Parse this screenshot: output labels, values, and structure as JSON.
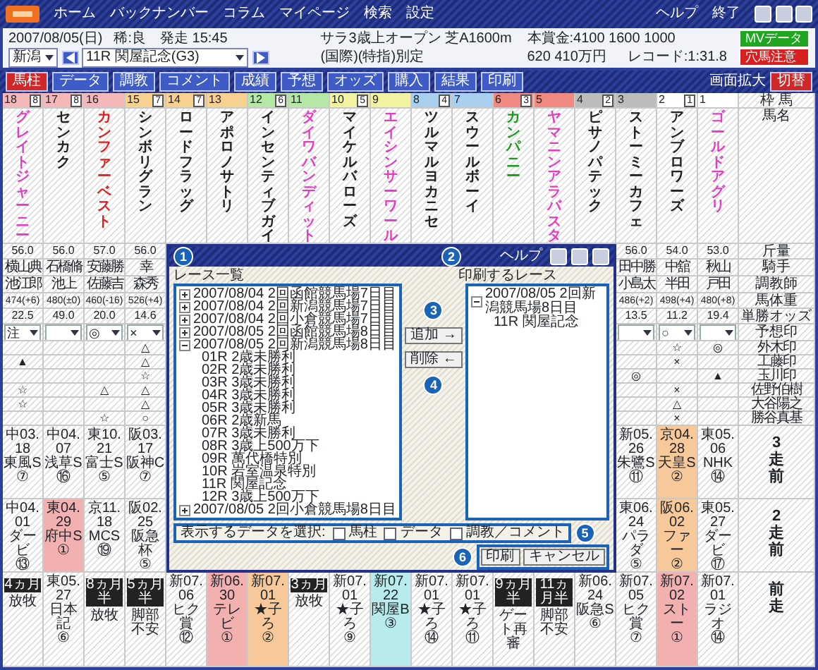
{
  "app": {
    "menu": [
      "ホーム",
      "バックナンバー",
      "コラム",
      "マイページ",
      "検索",
      "設定"
    ],
    "help": "ヘルプ",
    "quit": "終了"
  },
  "race_info": {
    "date": "2007/08/05(日)",
    "going": "稀:良",
    "post_time": "発走 15:45",
    "class": "サラ3歳上オープン 芝A1600m",
    "prize": "本賞金:4100 1600 1000",
    "record": "レコード:1:31.8",
    "track": "新潟",
    "race": "11R 関屋記念(G3)",
    "conditions": "(国際)(特指)別定",
    "prize_2": "620 410万円",
    "badges": [
      {
        "label": "MVデータ",
        "color": "#21a621"
      },
      {
        "label": "穴馬注意",
        "color": "#d82020"
      }
    ]
  },
  "toolbar": {
    "buttons": [
      {
        "label": "馬柱",
        "selected": true
      },
      {
        "label": "データ",
        "selected": false
      },
      {
        "label": "調教",
        "selected": false
      },
      {
        "label": "コメント",
        "selected": false
      },
      {
        "label": "成績",
        "selected": false
      },
      {
        "label": "予想",
        "selected": false
      },
      {
        "label": "オッズ",
        "selected": false
      },
      {
        "label": "購入",
        "selected": false
      },
      {
        "label": "結果",
        "selected": false
      },
      {
        "label": "印刷",
        "selected": false
      }
    ],
    "zoom_label": "画面拡大",
    "zoom_toggle": "切替"
  },
  "horses": [
    {
      "number": "18",
      "waku": "8",
      "color": "#f4b8b8",
      "name": "グレイトジャーニー",
      "kind": "pink",
      "weight": "56.0",
      "jockey": "横山典",
      "trainer": "池江郎",
      "body_weight": "474(+6)",
      "odds": "22.5",
      "mark": "注",
      "marks": {
        "row_2": "▲",
        "row_4": "☆",
        "row_5": "☆"
      },
      "race_3": {
        "kind": "race",
        "date": "中03.18",
        "race": "東風S",
        "rank": "⑦"
      },
      "race_2": {
        "kind": "race",
        "date": "中04.01",
        "race": "ダービ",
        "rank": "⑬"
      },
      "race_1": {
        "kind": "rest",
        "period": "4ヵ月",
        "reason": "放牧"
      }
    },
    {
      "number": "17",
      "waku": "8",
      "color": "#f4b8b8",
      "name": "センカク",
      "kind": "plain",
      "weight": "56.0",
      "jockey": "石橋脩",
      "trainer": "池上",
      "body_weight": "480(±0)",
      "odds": "49.0",
      "race_3": {
        "kind": "race",
        "date": "中04.07",
        "race": "浅草S",
        "rank": "⑯"
      },
      "race_2": {
        "kind": "race",
        "date": "東04.29",
        "race": "府中S",
        "rank": "①",
        "color": "#f2b0b0"
      },
      "race_1": {
        "kind": "race",
        "date": "東05.27",
        "race": "日本記",
        "rank": "⑥"
      }
    },
    {
      "number": "16",
      "color": "#f4b8b8",
      "name": "カンファーベスト",
      "kind": "red",
      "weight": "57.0",
      "jockey": "安藤勝",
      "trainer": "佐藤吉",
      "body_weight": "460(-16)",
      "odds": "20.0",
      "mark": "◎",
      "marks": {
        "row_4": "△",
        "row_6": "☆"
      },
      "race_3": {
        "kind": "race",
        "date": "東10.21",
        "race": "富士S",
        "rank": "⑤"
      },
      "race_2": {
        "kind": "race",
        "date": "京11.18",
        "race": "MCS",
        "rank": "⑲"
      },
      "race_1": {
        "kind": "rest",
        "period": "8ヵ月半",
        "reason": "放牧"
      }
    },
    {
      "number": "15",
      "waku": "7",
      "color": "#f8d090",
      "name": "シンボリグラン",
      "kind": "plain",
      "weight": "56.0",
      "jockey": "幸",
      "trainer": "森秀",
      "body_weight": "526(+4)",
      "odds": "14.6",
      "mark": "×",
      "marks": {
        "row_1": "△",
        "row_2": "△",
        "row_3": "☆",
        "row_4": "△",
        "row_5": "△",
        "row_6": "○"
      },
      "race_3": {
        "kind": "race",
        "date": "阪03.17",
        "race": "阪神C",
        "rank": "⑦"
      },
      "race_2": {
        "kind": "race",
        "date": "阪02.25",
        "race": "阪急杯",
        "rank": "⑤"
      },
      "race_1": {
        "kind": "rest",
        "period": "5ヵ月半",
        "reason": "脚部不安"
      }
    },
    {
      "number": "14",
      "waku": "7",
      "color": "#f8d090",
      "name": "ロードフラッグ",
      "kind": "plain",
      "race_1": {
        "kind": "race",
        "date": "新07.06",
        "race": "ヒク賞",
        "rank": "⑫"
      }
    },
    {
      "number": "13",
      "color": "#f8d090",
      "name": "アポロノサトリ",
      "kind": "plain",
      "race_1": {
        "kind": "race",
        "date": "新06.30",
        "race": "テレビ",
        "rank": "①",
        "color": "#f2b0b0"
      }
    },
    {
      "number": "12",
      "waku": "6",
      "color": "#b4e8a4",
      "name": "インセンティブガイ",
      "kind": "plain",
      "race_1": {
        "kind": "race",
        "date": "新07.01",
        "race": "★子ろ",
        "rank": "②",
        "color": "#f6c89a"
      }
    },
    {
      "number": "11",
      "color": "#b4e8a4",
      "name": "ダイワバンディット",
      "kind": "pink",
      "race_1": {
        "kind": "rest",
        "period": "3ヵ月",
        "reason": "放牧"
      }
    },
    {
      "number": "10",
      "waku": "5",
      "color": "#f2f2a0",
      "name": "マイケルバローズ",
      "kind": "plain",
      "race_1": {
        "kind": "race",
        "date": "新07.01",
        "race": "★子ろ",
        "rank": "⑨"
      }
    },
    {
      "number": "9",
      "color": "#f2f2a0",
      "name": "エイシンサーワール",
      "kind": "pink",
      "race_1": {
        "kind": "race",
        "date": "新07.22",
        "race": "関屋B",
        "rank": "③",
        "color": "#b8ecec"
      }
    },
    {
      "number": "8",
      "waku": "4",
      "color": "#a8cff0",
      "name": "ツルマルヨカニセ",
      "kind": "plain",
      "race_1": {
        "kind": "race",
        "date": "新07.01",
        "race": "★子ろ",
        "rank": "⑭"
      }
    },
    {
      "number": "7",
      "color": "#a8cff0",
      "name": "スウールボーイ",
      "kind": "plain",
      "race_1": {
        "kind": "race",
        "date": "新07.01",
        "race": "★子ろ",
        "rank": "⑪"
      }
    },
    {
      "number": "6",
      "waku": "3",
      "color": "#f08a80",
      "name": "カンパニー",
      "kind": "green",
      "race_1": {
        "kind": "rest",
        "period": "9ヵ月半",
        "reason": "ゲート再審"
      }
    },
    {
      "number": "5",
      "color": "#f08a80",
      "name": "ヤマニンアラバスタ",
      "kind": "pink",
      "race_1": {
        "kind": "rest",
        "period": "11ヵ月半",
        "reason": "脚部不安"
      }
    },
    {
      "number": "4",
      "waku": "2",
      "color": "#bcbcbc",
      "name": "ピサノパテック",
      "kind": "plain",
      "race_1": {
        "kind": "race",
        "date": "新06.24",
        "race": "阪急S",
        "rank": "⑥"
      }
    },
    {
      "number": "3",
      "color": "#bcbcbc",
      "name": "ストーミーカフェ",
      "kind": "plain",
      "weight": "56.0",
      "jockey": "田中勝",
      "trainer": "小島太",
      "body_weight": "486(+2)",
      "odds": "13.5",
      "marks": {
        "row_3": "◎"
      },
      "race_3": {
        "kind": "race",
        "date": "新05.26",
        "race": "朱鷺S",
        "rank": "⑪"
      },
      "race_2": {
        "kind": "race",
        "date": "東06.24",
        "race": "パラダ",
        "rank": "⑤"
      },
      "race_1": {
        "kind": "race",
        "date": "新07.05",
        "race": "ヒク賞",
        "rank": "⑦"
      }
    },
    {
      "number": "2",
      "waku": "1",
      "color": "#ffffff",
      "name": "アンブロワーズ",
      "kind": "plain",
      "weight": "54.0",
      "jockey": "中舘",
      "trainer": "半田",
      "body_weight": "498(+4)",
      "odds": "11.2",
      "mark": "○",
      "marks": {
        "row_1": "☆",
        "row_2": "×",
        "row_4": "×",
        "row_5": "△",
        "row_6": "×"
      },
      "race_3": {
        "kind": "race",
        "date": "京04.28",
        "race": "天皇S",
        "rank": "②",
        "color": "#f6c89a"
      },
      "race_2": {
        "kind": "race",
        "date": "阪06.02",
        "race": "ファー",
        "rank": "②",
        "color": "#f6c89a"
      },
      "race_1": {
        "kind": "race",
        "date": "新07.02",
        "race": "ストー",
        "rank": "①",
        "color": "#f2b0b0"
      }
    },
    {
      "number": "1",
      "color": "#ffffff",
      "name": "ゴールドアグリ",
      "kind": "pink",
      "weight": "53.0",
      "jockey": "秋山",
      "trainer": "戸田",
      "body_weight": "480(+8)",
      "odds": "19.4",
      "marks": {
        "row_1": "◎",
        "row_3": "▲"
      },
      "race_3": {
        "kind": "race",
        "date": "東05.06",
        "race": "NHK",
        "rank": "⑭"
      },
      "race_2": {
        "kind": "race",
        "date": "東05.27",
        "race": "ダービ",
        "rank": "⑰"
      },
      "race_1": {
        "kind": "race",
        "date": "新07.01",
        "race": "ラジオ",
        "rank": "⑭"
      }
    }
  ],
  "row_labels": {
    "head": "枠 馬",
    "name": "馬名",
    "weight": "斤量",
    "jockey": "騎手",
    "trainer": "調教師",
    "body_weight": "馬体重",
    "odds": "単勝オッズ",
    "mark": "予想印",
    "mark_rows": [
      "外木印",
      "工藤印",
      "玉川印",
      "佐野伯樹",
      "大谷陽之",
      "勝谷真基"
    ],
    "race_3": "3走前",
    "race_2": "2走前",
    "race_1": "前走"
  },
  "dialog": {
    "title": "ヘルプ",
    "list_label": "レース一覧",
    "print_label": "印刷するレース",
    "race_tree": [
      {
        "label": "2007/08/04 2回函館競馬場7日目",
        "expanded": false
      },
      {
        "label": "2007/08/04 2回新潟競馬場7日目",
        "expanded": false
      },
      {
        "label": "2007/08/04 2回小倉競馬場7日目",
        "expanded": false
      },
      {
        "label": "2007/08/05 2回函館競馬場8日目",
        "expanded": false
      },
      {
        "label": "2007/08/05 2回新潟競馬場8日目",
        "expanded": true,
        "children": [
          {
            "label": "01R 2歳未勝利"
          },
          {
            "label": "02R 2歳未勝利"
          },
          {
            "label": "03R 3歳未勝利"
          },
          {
            "label": "04R 3歳未勝利"
          },
          {
            "label": "05R 3歳未勝利"
          },
          {
            "label": "06R 2歳新馬"
          },
          {
            "label": "07R 3歳未勝利"
          },
          {
            "label": "08R 3歳上500万下"
          },
          {
            "label": "09R 萬代橋特別"
          },
          {
            "label": "10R 岩室温泉特別"
          },
          {
            "label": "11R 関屋記念"
          },
          {
            "label": "12R 3歳上500万下"
          }
        ]
      },
      {
        "label": "2007/08/05 2回小倉競馬場8日目",
        "expanded": false
      }
    ],
    "print_tree": [
      {
        "label": "2007/08/05 2回新潟競馬場8日目",
        "expanded": true,
        "children": [
          {
            "label": "11R 関屋記念"
          }
        ]
      }
    ],
    "add_button": "追加 →",
    "remove_button": "削除 ←",
    "select_label": "表示するデータを選択:",
    "options": [
      {
        "label": "馬柱",
        "checked": false
      },
      {
        "label": "データ",
        "checked": false
      },
      {
        "label": "調教／コメント",
        "checked": false
      }
    ],
    "print_button": "印刷",
    "cancel_button": "キャンセル"
  },
  "callouts": [
    "1",
    "2",
    "3",
    "4",
    "5",
    "6"
  ]
}
